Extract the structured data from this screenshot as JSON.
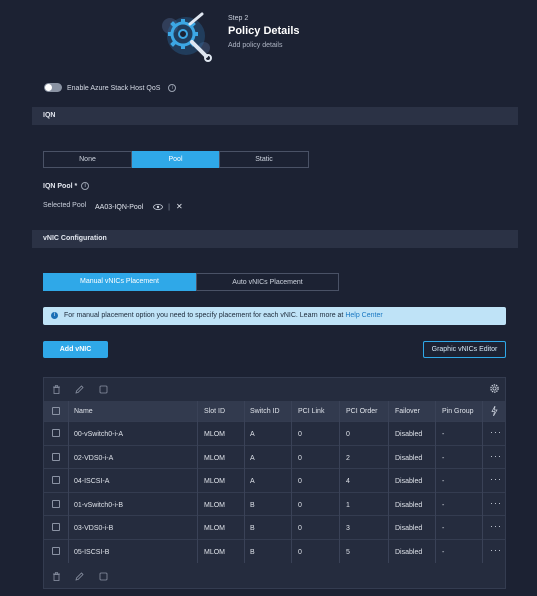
{
  "header": {
    "step": "Step 2",
    "title": "Policy Details",
    "subtitle": "Add policy details"
  },
  "qos": {
    "label": "Enable Azure Stack Host QoS",
    "enabled": false
  },
  "iqn": {
    "section_title": "IQN",
    "options": [
      "None",
      "Pool",
      "Static"
    ],
    "selected": "Pool",
    "pool_label": "IQN Pool *",
    "selected_pool_label": "Selected Pool",
    "selected_pool_value": "AA03-IQN-Pool"
  },
  "vnic": {
    "section_title": "vNIC Configuration",
    "tabs": [
      "Manual vNICs Placement",
      "Auto vNICs Placement"
    ],
    "active_tab": "Manual vNICs Placement",
    "info_text": "For manual placement option you need to specify placement for each vNIC. Learn more at ",
    "info_link": "Help Center",
    "add_button": "Add vNIC",
    "graphic_editor_button": "Graphic vNICs Editor"
  },
  "table": {
    "columns": [
      "Name",
      "Slot ID",
      "Switch ID",
      "PCI Link",
      "PCI Order",
      "Failover",
      "Pin Group"
    ],
    "rows": [
      [
        "00-vSwitch0-i-A",
        "MLOM",
        "A",
        "0",
        "0",
        "Disabled",
        "-"
      ],
      [
        "02-VDS0-i-A",
        "MLOM",
        "A",
        "0",
        "2",
        "Disabled",
        "-"
      ],
      [
        "04-ISCSI-A",
        "MLOM",
        "A",
        "0",
        "4",
        "Disabled",
        "-"
      ],
      [
        "01-vSwitch0-i-B",
        "MLOM",
        "B",
        "0",
        "1",
        "Disabled",
        "-"
      ],
      [
        "03-VDS0-i-B",
        "MLOM",
        "B",
        "0",
        "3",
        "Disabled",
        "-"
      ],
      [
        "05-ISCSI-B",
        "MLOM",
        "B",
        "0",
        "5",
        "Disabled",
        "-"
      ]
    ],
    "row_actions": "···"
  },
  "icons": [
    "settings-gear-icon",
    "info-icon",
    "eye-icon",
    "close-icon",
    "trash-icon",
    "pencil-icon",
    "copy-icon",
    "gear-icon",
    "lightning-icon",
    "more-icon"
  ],
  "colors": {
    "accent": "#2fa8e8",
    "background": "#1c2233",
    "banner": "#bfe3f7"
  }
}
